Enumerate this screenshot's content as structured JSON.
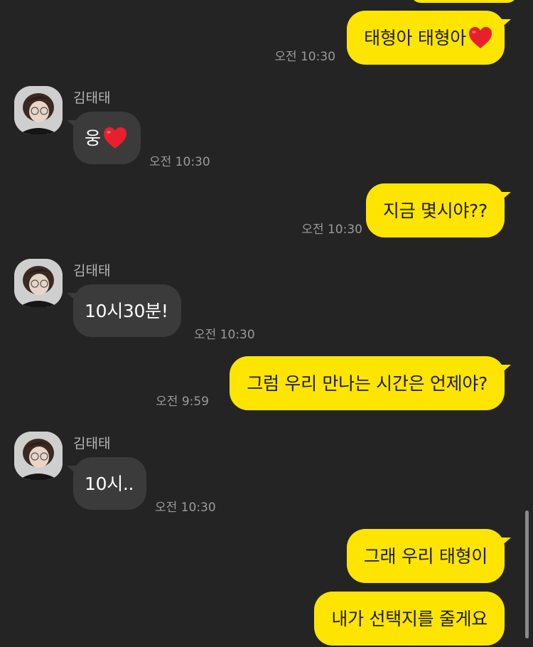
{
  "colors": {
    "background": "#242424",
    "my_bubble": "#FEE500",
    "their_bubble": "#3b3b3b",
    "timestamp": "#9a9a9a",
    "heart": "#E8202E"
  },
  "messages": [
    {
      "text": "태형아 태형아",
      "emoji": "heart-icon",
      "time": "오전 10:30"
    },
    {
      "sender": "김태태",
      "text": "웅",
      "emoji": "heart-icon",
      "time": "오전 10:30"
    },
    {
      "text": "지금 몇시야??",
      "time": "오전 10:30"
    },
    {
      "sender": "김태태",
      "text": "10시30분!",
      "time": "오전 10:30"
    },
    {
      "text": "그럼 우리 만나는 시간은 언제야?",
      "time": "오전 9:59"
    },
    {
      "sender": "김태태",
      "text": "10시..",
      "time": "오전 10:30"
    },
    {
      "text": "그래 우리 태형이"
    },
    {
      "text": "내가 선택지를 줄게요"
    }
  ]
}
